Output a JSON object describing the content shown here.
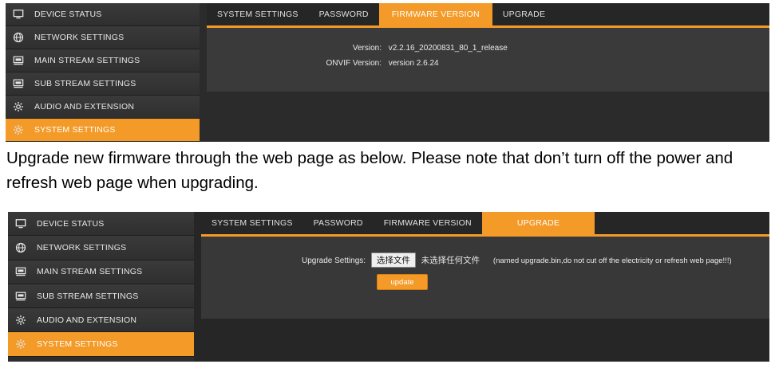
{
  "screenshot1": {
    "sidebar": [
      {
        "label": "DEVICE STATUS",
        "icon": "monitor-icon",
        "active": false
      },
      {
        "label": "NETWORK SETTINGS",
        "icon": "globe-icon",
        "active": false
      },
      {
        "label": "MAIN STREAM SETTINGS",
        "icon": "stream-icon",
        "active": false
      },
      {
        "label": "SUB STREAM SETTINGS",
        "icon": "stream-icon",
        "active": false
      },
      {
        "label": "AUDIO AND EXTENSION",
        "icon": "gear-icon",
        "active": false
      },
      {
        "label": "SYSTEM SETTINGS",
        "icon": "gear-icon",
        "active": true
      }
    ],
    "tabs": [
      {
        "label": "SYSTEM SETTINGS",
        "active": false
      },
      {
        "label": "PASSWORD",
        "active": false
      },
      {
        "label": "FIRMWARE VERSION",
        "active": true
      },
      {
        "label": "UPGRADE",
        "active": false
      }
    ],
    "firmware": {
      "version_label": "Version:",
      "version_value": "v2.2.16_20200831_80_1_release",
      "onvif_label": "ONVIF Version:",
      "onvif_value": "version 2.6.24"
    }
  },
  "caption": "Upgrade new firmware through the web page as below. Please note that don’t turn off the power and refresh web page when upgrading.",
  "screenshot2": {
    "sidebar": [
      {
        "label": "DEVICE STATUS",
        "icon": "monitor-icon",
        "active": false
      },
      {
        "label": "NETWORK SETTINGS",
        "icon": "globe-icon",
        "active": false
      },
      {
        "label": "MAIN STREAM SETTINGS",
        "icon": "stream-icon",
        "active": false
      },
      {
        "label": "SUB STREAM SETTINGS",
        "icon": "stream-icon",
        "active": false
      },
      {
        "label": "AUDIO AND EXTENSION",
        "icon": "gear-icon",
        "active": false
      },
      {
        "label": "SYSTEM SETTINGS",
        "icon": "gear-icon",
        "active": true
      }
    ],
    "tabs": [
      {
        "label": "SYSTEM SETTINGS",
        "active": false
      },
      {
        "label": "PASSWORD",
        "active": false
      },
      {
        "label": "FIRMWARE VERSION",
        "active": false
      },
      {
        "label": "UPGRADE",
        "active": true
      }
    ],
    "upgrade": {
      "label": "Upgrade Settings:",
      "choose_file": "选择文件",
      "no_file": "未选择任何文件",
      "note": "(named upgrade.bin,do not cut off the electricity or refresh web page!!!)",
      "update_button": "update"
    }
  },
  "colors": {
    "accent": "#f39a28",
    "sidebar_bg": "#2e2e2e",
    "panel_bg": "#3a3a3a"
  }
}
